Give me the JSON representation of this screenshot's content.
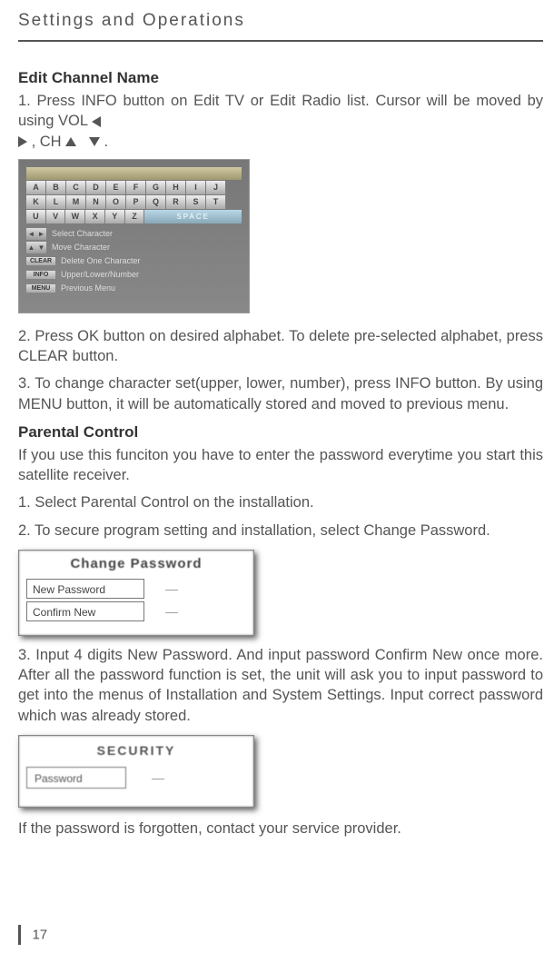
{
  "header": "Settings and Operations",
  "section1": {
    "title": "Edit Channel Name",
    "p1a": "1. Press INFO button on Edit TV or Edit Radio list.  Cursor will be moved by using VOL",
    "p1b": " , CH",
    "p1c": " .",
    "p2": "2. Press OK button on desired alphabet.  To delete pre-selected alphabet, press CLEAR button.",
    "p3": "3. To change character set(upper, lower, number), press INFO button.  By using MENU button, it will be automatically stored and moved to previous menu."
  },
  "fig1": {
    "row1": [
      "A",
      "B",
      "C",
      "D",
      "E",
      "F",
      "G",
      "H",
      "I",
      "J"
    ],
    "row2": [
      "K",
      "L",
      "M",
      "N",
      "O",
      "P",
      "Q",
      "R",
      "S",
      "T"
    ],
    "row3": [
      "U",
      "V",
      "W",
      "X",
      "Y",
      "Z"
    ],
    "space": "SPACE",
    "legend": [
      {
        "btn": "◄►",
        "text": "Select Character"
      },
      {
        "btn": "▲▼",
        "text": "Move Character"
      },
      {
        "btn": "CLEAR",
        "text": "Delete One Character"
      },
      {
        "btn": "INFO",
        "text": "Upper/Lower/Number"
      },
      {
        "btn": "MENU",
        "text": "Previous Menu"
      }
    ]
  },
  "section2": {
    "title": "Parental Control",
    "p1": "If you use this funciton you have to enter the password everytime you start this satellite receiver.",
    "p2": "1. Select Parental Control on the installation.",
    "p3": "2. To secure program setting and installation, select Change Password."
  },
  "fig2": {
    "title": "Change  Password",
    "row1": "New  Password",
    "row2": "Confirm  New",
    "dash": "—"
  },
  "section3": {
    "p1": "3. Input 4 digits New Password.  And input password Confirm New once more.  After all the password function is set, the unit will ask you to input password to get into the menus of Installation and System Settings.  Input correct password which was already stored."
  },
  "fig3": {
    "title": "SECURITY",
    "row1": "Password",
    "dash": "—"
  },
  "section4": {
    "p1": "If the password is forgotten, contact your service provider."
  },
  "page": "17"
}
